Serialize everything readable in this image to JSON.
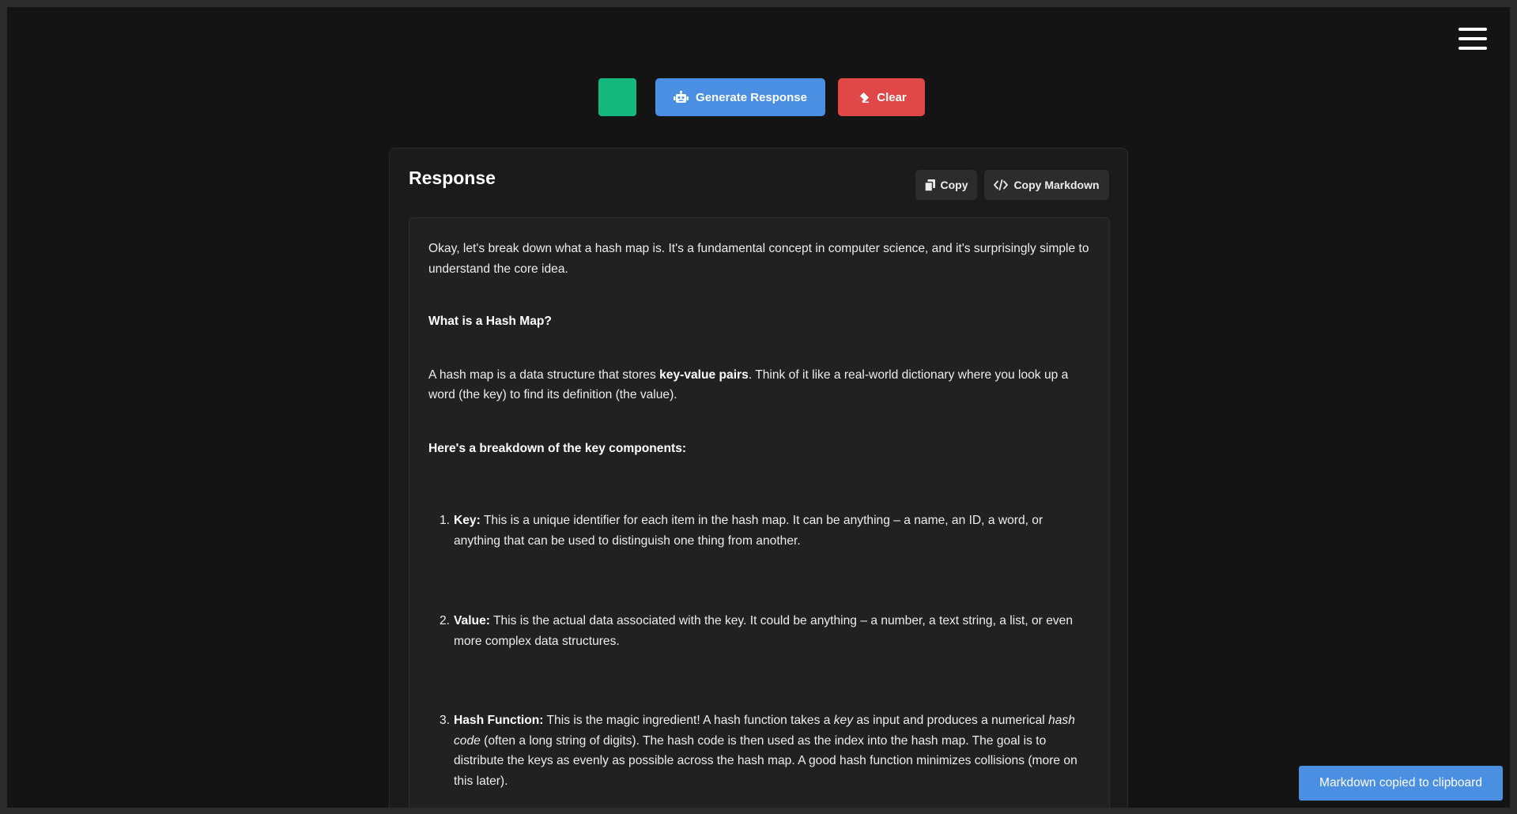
{
  "toolbar": {
    "generate_label": "Generate Response",
    "clear_label": "Clear"
  },
  "response": {
    "title": "Response",
    "copy_label": "Copy",
    "copy_markdown_label": "Copy Markdown",
    "intro": "Okay, let's break down what a hash map is. It's a fundamental concept in computer science, and it's surprisingly simple to understand the core idea.",
    "heading1": "What is a Hash Map?",
    "para2_start": "A hash map is a data structure that stores ",
    "para2_bold": "key-value pairs",
    "para2_end": ".  Think of it like a real-world dictionary where you look up a word (the key) to find its definition (the value).",
    "heading2": "Here's a breakdown of the key components:",
    "items": [
      {
        "num": "1.",
        "label": "Key:",
        "text": "  This is a unique identifier for each item in the hash map.  It can be anything – a name, an ID, a word, or anything that can be used to distinguish one thing from another."
      },
      {
        "num": "2.",
        "label": "Value:",
        "text": "  This is the actual data associated with the key.  It could be anything – a number, a text string, a list, or even more complex data structures."
      },
      {
        "num": "3.",
        "label": "Hash Function:",
        "t1": " This is the magic ingredient!  A hash function takes a ",
        "i1": "key",
        "t2": " as input and produces a numerical ",
        "i2": "hash code",
        "t3": " (often a long string of digits).  The hash code is then used as the index into the hash map.  The goal is to distribute the keys as evenly as possible across the hash map.  A good hash function minimizes collisions (more on this later)."
      }
    ]
  },
  "toast": {
    "message": "Markdown copied to clipboard"
  },
  "colors": {
    "background": "#141414",
    "accent_green": "#14b87d",
    "accent_blue": "#4a8fe2",
    "accent_red": "#e04747"
  }
}
